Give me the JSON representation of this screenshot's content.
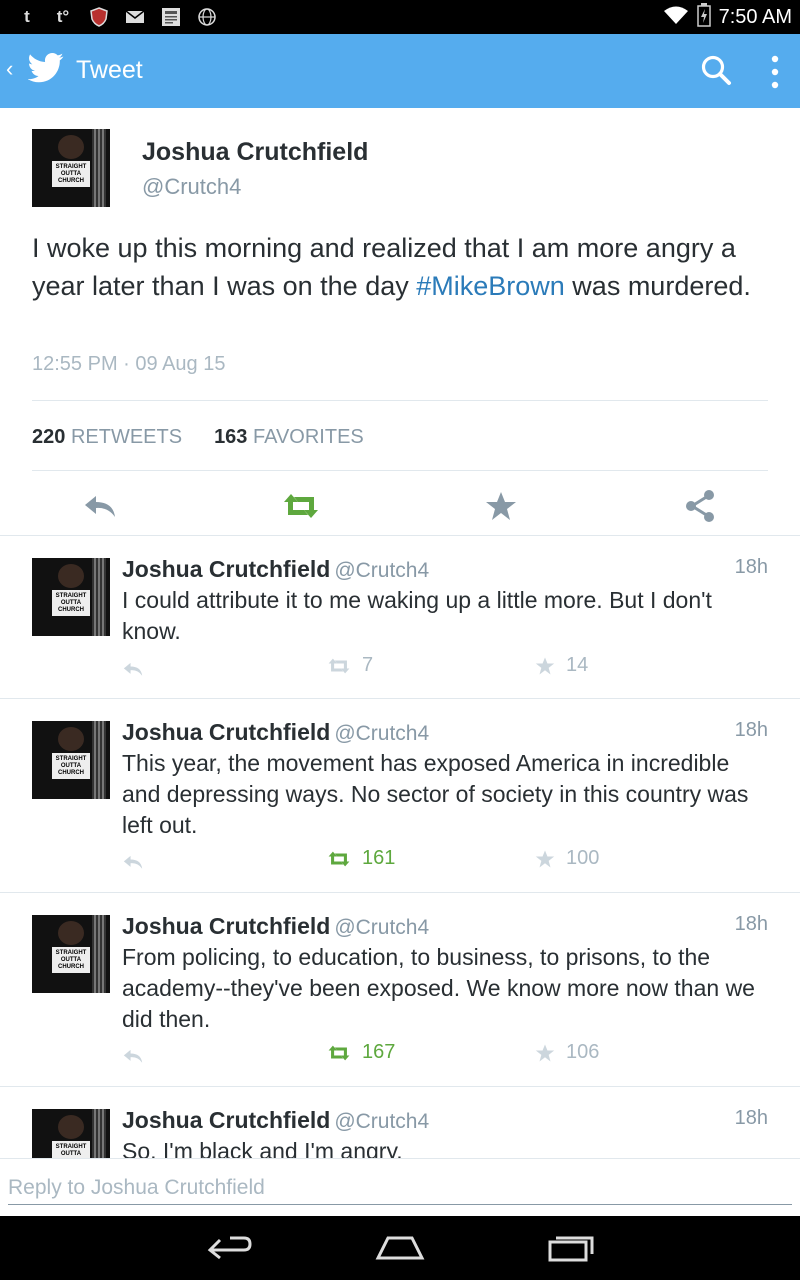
{
  "status_bar": {
    "time": "7:50 AM",
    "left_icons": [
      "tumblr-icon",
      "tumblr-notify-icon",
      "shield-app-icon",
      "mail-icon",
      "news-icon",
      "globe-icon"
    ],
    "right_icons": [
      "wifi-icon",
      "battery-icon"
    ]
  },
  "app_bar": {
    "title": "Tweet",
    "bg_color": "#55acee"
  },
  "main_tweet": {
    "author_name": "Joshua Crutchfield",
    "author_handle": "@Crutch4",
    "text_before": "I woke up this morning and realized that I am more angry a year later than I was on the day ",
    "hashtag": "#MikeBrown",
    "text_after": " was murdered.",
    "timestamp": "12:55 PM · 09 Aug 15",
    "retweets_count": "220",
    "retweets_label": "RETWEETS",
    "favorites_count": "163",
    "favorites_label": "FAVORITES"
  },
  "replies": [
    {
      "name": "Joshua Crutchfield",
      "handle": "@Crutch4",
      "time": "18h",
      "text": "I could attribute it to me waking up a little more. But I don't know.",
      "retweets": "7",
      "favorites": "14"
    },
    {
      "name": "Joshua Crutchfield",
      "handle": "@Crutch4",
      "time": "18h",
      "text": "This year, the movement has exposed America in incredible and depressing ways. No sector of society in this country was left out.",
      "retweets": "161",
      "favorites": "100"
    },
    {
      "name": "Joshua Crutchfield",
      "handle": "@Crutch4",
      "time": "18h",
      "text": "From policing, to education, to business, to prisons, to the academy--they've been exposed. We know more now than we did then.",
      "retweets": "167",
      "favorites": "106"
    },
    {
      "name": "Joshua Crutchfield",
      "handle": "@Crutch4",
      "time": "18h",
      "text": "So, I'm black and I'm angry."
    }
  ],
  "compose": {
    "placeholder": "Reply to Joshua Crutchfield"
  },
  "avatar_text": "STRAIGHT OUTTA CHURCH",
  "colors": {
    "accent": "#55acee",
    "link": "#2b7bb9",
    "retweet_green": "#5ea83e",
    "muted": "#8899a6"
  }
}
